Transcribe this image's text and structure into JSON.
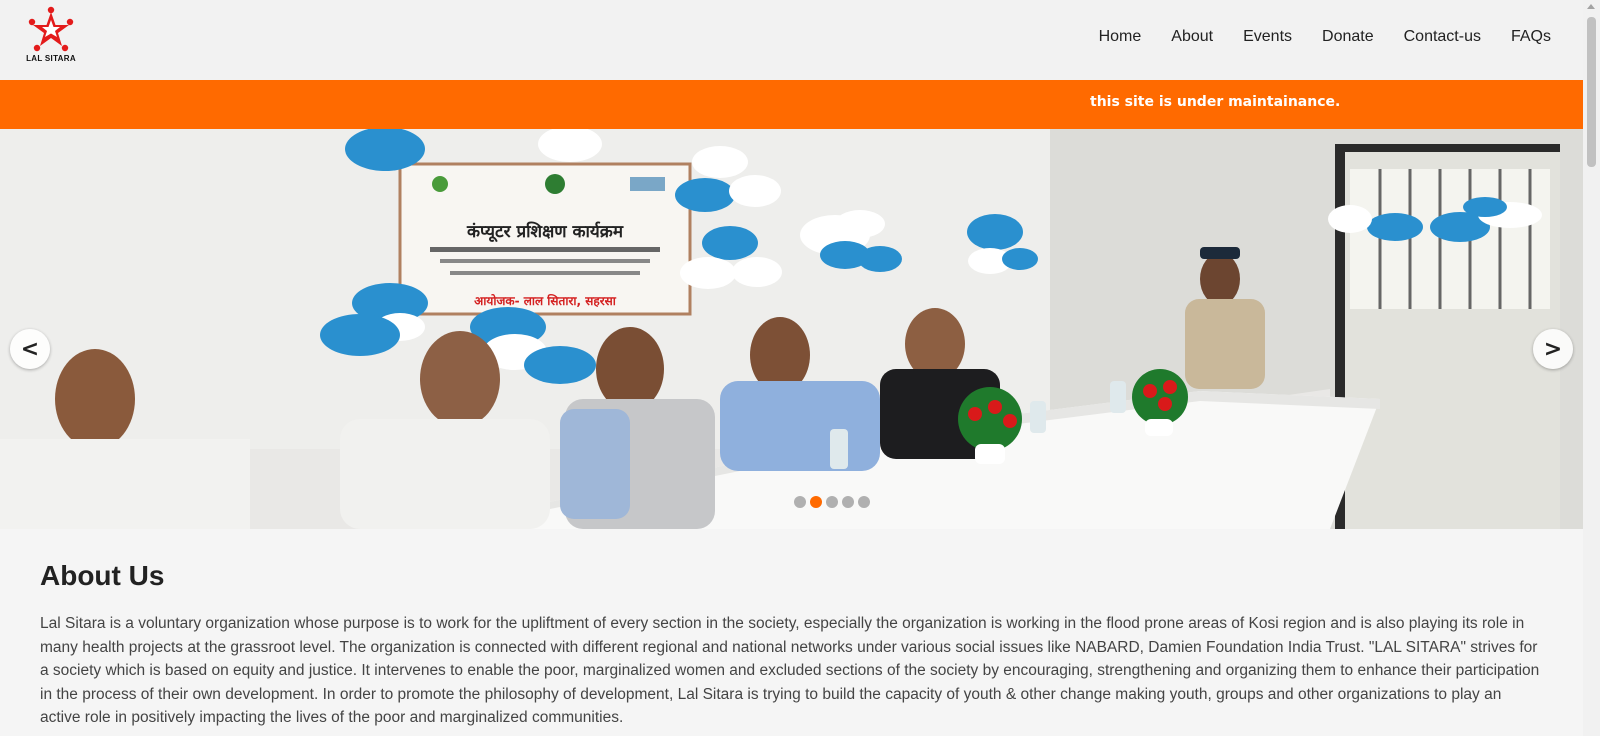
{
  "brand": {
    "logo_text": "LAL SITARA",
    "icon": "lal-sitara-star-logo"
  },
  "nav": {
    "items": [
      "Home",
      "About",
      "Events",
      "Donate",
      "Contact-us",
      "FAQs"
    ]
  },
  "banner": {
    "text": "this site is under maintainance."
  },
  "slider": {
    "prev_label": "<",
    "next_label": ">",
    "slide_count": 5,
    "active_slide": 2,
    "slide": {
      "sign_title": "कंप्यूटर प्रशिक्षण कार्यक्रम",
      "sign_organizer": "आयोजक- लाल सितारा, सहरसा"
    }
  },
  "about": {
    "heading": "About Us",
    "text": "Lal Sitara is a voluntary organization whose purpose is to work for the upliftment of every section in the society, especially the organization is working in the flood prone areas of Kosi region and is also playing its role in many health projects at the grassroot level. The organization is connected with different regional and national networks under various social issues like NABARD, Damien Foundation India Trust. \"LAL SITARA\" strives for a society which is based on equity and justice. It intervenes to enable the poor, marginalized women and excluded sections of the society by encouraging, strengthening and organizing them to enhance their participation in the process of their own development. In order to promote the philosophy of development, Lal Sitara is trying to build the capacity of youth & other change making youth, groups and other organizations to play an active role in positively impacting the lives of the poor and marginalized communities."
  },
  "colors": {
    "accent": "#ff6a00",
    "header_bg": "#f2f2f2",
    "page_bg": "#f5f5f5"
  }
}
